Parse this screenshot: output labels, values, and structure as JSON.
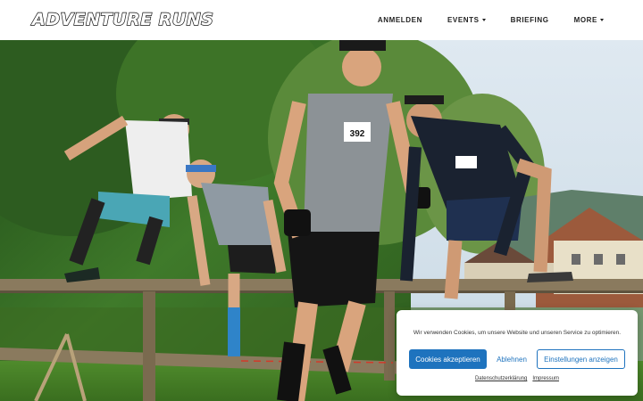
{
  "brand": {
    "logo_text": "Adventure Runs"
  },
  "nav": {
    "items": [
      {
        "label": "ANMELDEN",
        "dropdown": false
      },
      {
        "label": "EVENTS",
        "dropdown": true
      },
      {
        "label": "BRIEFING",
        "dropdown": false
      },
      {
        "label": "MORE",
        "dropdown": true
      }
    ]
  },
  "hero": {
    "bib_number_center": "392",
    "image_subject": "obstacle-race-runners-jumping-fence"
  },
  "cookie_banner": {
    "message": "Wir verwenden Cookies, um unsere Website und unseren Service zu optimieren.",
    "accept_label": "Cookies akzeptieren",
    "deny_label": "Ablehnen",
    "settings_label": "Einstellungen anzeigen",
    "privacy_link": "Datenschutzerklärung",
    "imprint_link": "Impressum",
    "accent_color": "#1e73be"
  }
}
